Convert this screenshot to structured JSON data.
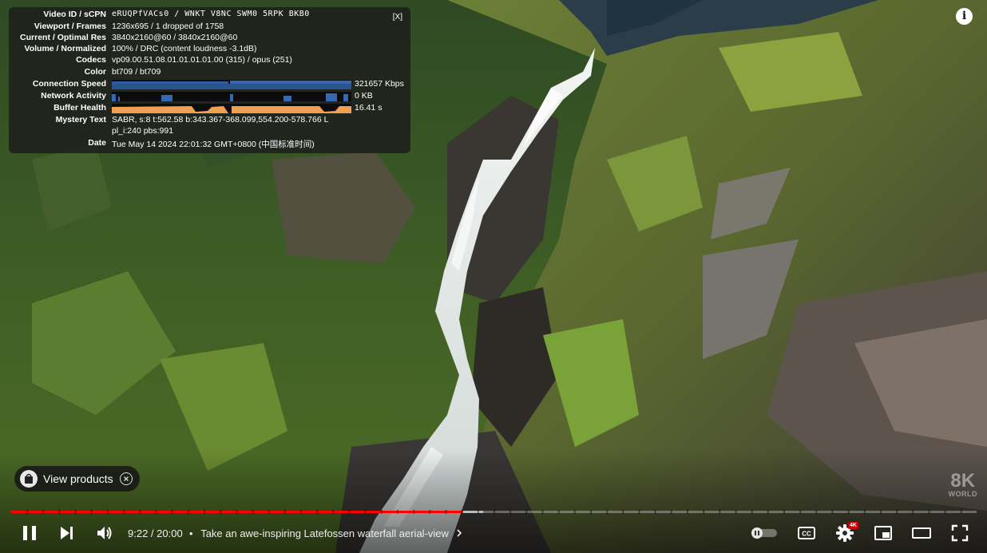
{
  "stats": {
    "close_label": "[X]",
    "rows": [
      {
        "label": "Video ID / sCPN",
        "value": "eRUQPfVACs0 / WNKT V8NC SWM0 5RPK BKB0"
      },
      {
        "label": "Viewport / Frames",
        "value": "1236x695 / 1 dropped of 1758"
      },
      {
        "label": "Current / Optimal Res",
        "value": "3840x2160@60 / 3840x2160@60"
      },
      {
        "label": "Volume / Normalized",
        "value": "100% / DRC (content loudness -3.1dB)"
      },
      {
        "label": "Codecs",
        "value": "vp09.00.51.08.01.01.01.01.00 (315) / opus (251)"
      },
      {
        "label": "Color",
        "value": "bt709 / bt709"
      }
    ],
    "graphs": [
      {
        "label": "Connection Speed",
        "value": "321657 Kbps"
      },
      {
        "label": "Network Activity",
        "value": "0 KB"
      },
      {
        "label": "Buffer Health",
        "value": "16.41 s"
      }
    ],
    "mystery_label": "Mystery Text",
    "mystery_line1": "SABR, s:8 t:562.58 b:343.367-368.099,554.200-578.766 L",
    "mystery_line2": "pl_i:240 pbs:991",
    "date_label": "Date",
    "date_value": "Tue May 14 2024 22:01:32 GMT+0800 (中国标准时间)"
  },
  "overlay": {
    "info_icon": "info-icon",
    "info_glyph": "i",
    "view_products_label": "View products",
    "watermark_big": "8K",
    "watermark_small": "WORLD"
  },
  "player": {
    "current_time": "9:22",
    "duration": "20:00",
    "time_display": "9:22 / 20:00",
    "chapter_separator": "•",
    "chapter_title": "Take an awe-inspiring Latefossen waterfall aerial-view",
    "played_fraction": 0.4683,
    "buffered_fraction": 0.4894,
    "settings_badge": "4K",
    "accent_color": "#ff0000",
    "icons": [
      "pause-icon",
      "next-icon",
      "volume-icon",
      "autoplay-toggle",
      "subtitles-icon",
      "settings-icon",
      "miniplayer-icon",
      "theater-icon",
      "fullscreen-icon"
    ]
  }
}
